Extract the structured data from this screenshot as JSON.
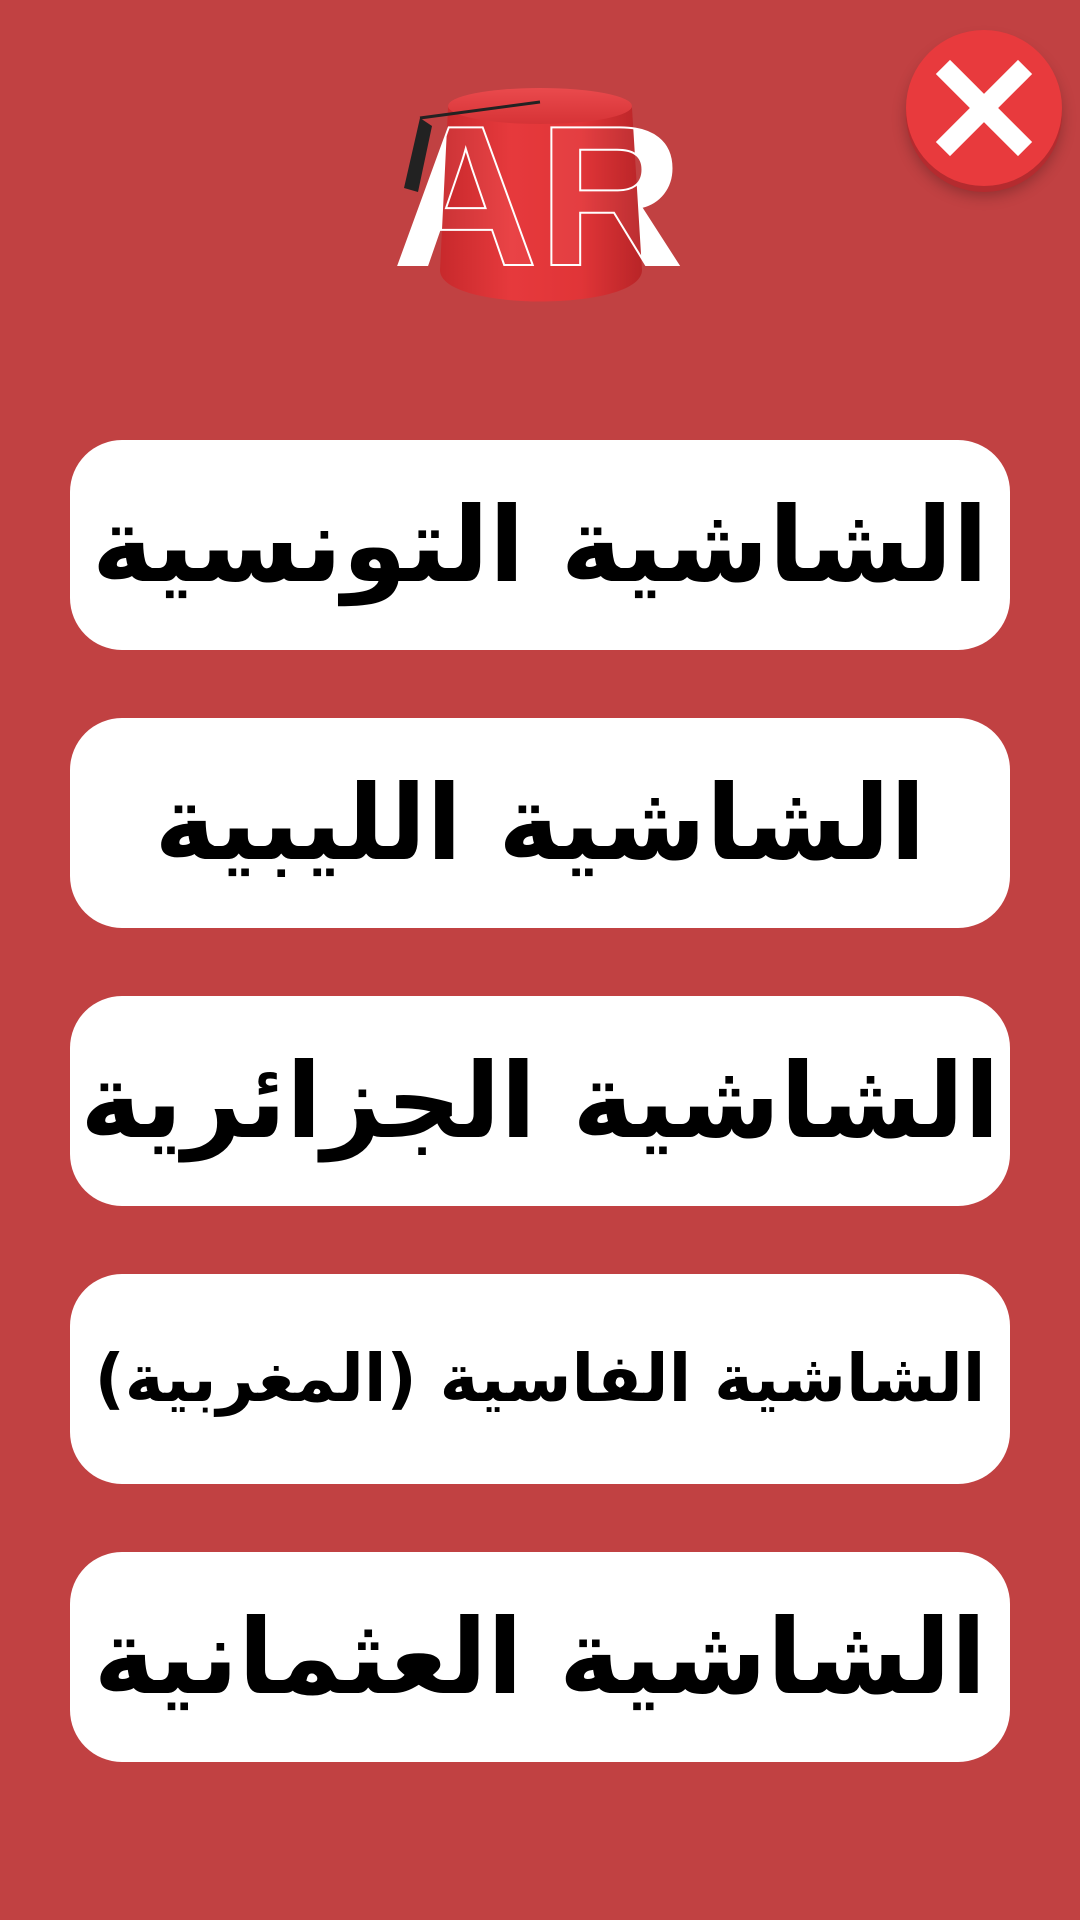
{
  "app": {
    "background_color": "#c14142",
    "logo": {
      "text": "AR",
      "icon": "fez-hat-icon"
    }
  },
  "close_button": {
    "icon": "close-icon",
    "color": "#e83a3d"
  },
  "menu": {
    "items": [
      {
        "label": "الشاشية التونسية"
      },
      {
        "label": "الشاشية الليبية"
      },
      {
        "label": "الشاشية الجزائرية"
      },
      {
        "label": "الشاشية الفاسية (المغربية)"
      },
      {
        "label": "الشاشية العثمانية"
      }
    ]
  }
}
